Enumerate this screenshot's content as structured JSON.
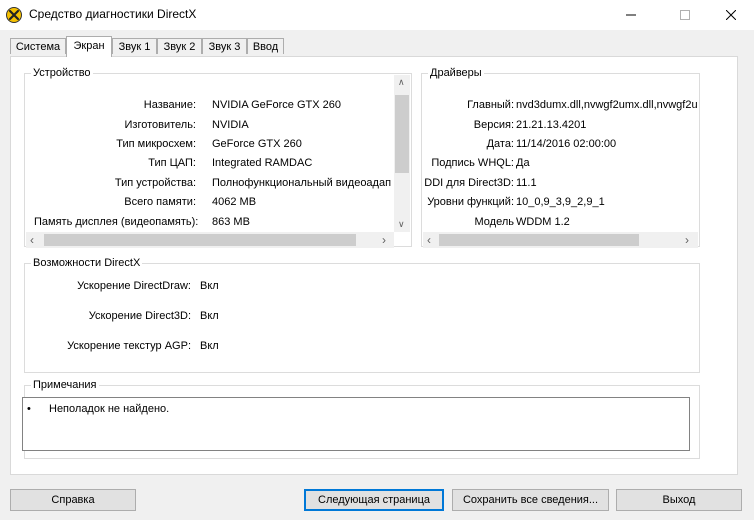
{
  "window": {
    "title": "Средство диагностики DirectX"
  },
  "tabs": [
    {
      "label": "Система"
    },
    {
      "label": "Экран"
    },
    {
      "label": "Звук 1"
    },
    {
      "label": "Звук 2"
    },
    {
      "label": "Звук 3"
    },
    {
      "label": "Ввод"
    }
  ],
  "device": {
    "title": "Устройство",
    "rows": [
      {
        "label": "Название:",
        "value": "NVIDIA GeForce GTX 260"
      },
      {
        "label": "Изготовитель:",
        "value": "NVIDIA"
      },
      {
        "label": "Тип микросхем:",
        "value": "GeForce GTX 260"
      },
      {
        "label": "Тип ЦАП:",
        "value": "Integrated RAMDAC"
      },
      {
        "label": "Тип устройства:",
        "value": "Полнофункциональный видеоадап"
      },
      {
        "label": "Всего памяти:",
        "value": "4062 MB"
      },
      {
        "label": "Память дисплея (видеопамять):",
        "value": "863 MB"
      }
    ]
  },
  "drivers": {
    "title": "Драйверы",
    "rows": [
      {
        "label": "Главный:",
        "value": "nvd3dumx.dll,nvwgf2umx.dll,nvwgf2u"
      },
      {
        "label": "Версия:",
        "value": "21.21.13.4201"
      },
      {
        "label": "Дата:",
        "value": "11/14/2016 02:00:00"
      },
      {
        "label": "Подпись WHQL:",
        "value": "Да"
      },
      {
        "label": "DDI для Direct3D:",
        "value": "11.1"
      },
      {
        "label": "Уровни функций:",
        "value": "10_0,9_3,9_2,9_1"
      },
      {
        "label": "Модель",
        "value": "WDDM 1.2"
      }
    ]
  },
  "directx_features": {
    "title": "Возможности DirectX",
    "rows": [
      {
        "label": "Ускорение DirectDraw:",
        "value": "Вкл"
      },
      {
        "label": "Ускорение Direct3D:",
        "value": "Вкл"
      },
      {
        "label": "Ускорение текстур AGP:",
        "value": "Вкл"
      }
    ]
  },
  "notes": {
    "title": "Примечания",
    "items": [
      "Неполадок не найдено."
    ]
  },
  "buttons": {
    "help": "Справка",
    "next_page": "Следующая страница",
    "save_all": "Сохранить все сведения...",
    "exit": "Выход"
  },
  "colors": {
    "window_bg": "#f0f0f0",
    "panel_bg": "#ffffff",
    "accent": "#0078d7",
    "icon_yellow": "#f5c000"
  },
  "icons": [
    "directx-app-icon",
    "minimize-icon",
    "maximize-icon",
    "close-icon",
    "chevron-left-icon",
    "chevron-right-icon",
    "chevron-up-icon",
    "chevron-down-icon",
    "bullet-icon"
  ]
}
